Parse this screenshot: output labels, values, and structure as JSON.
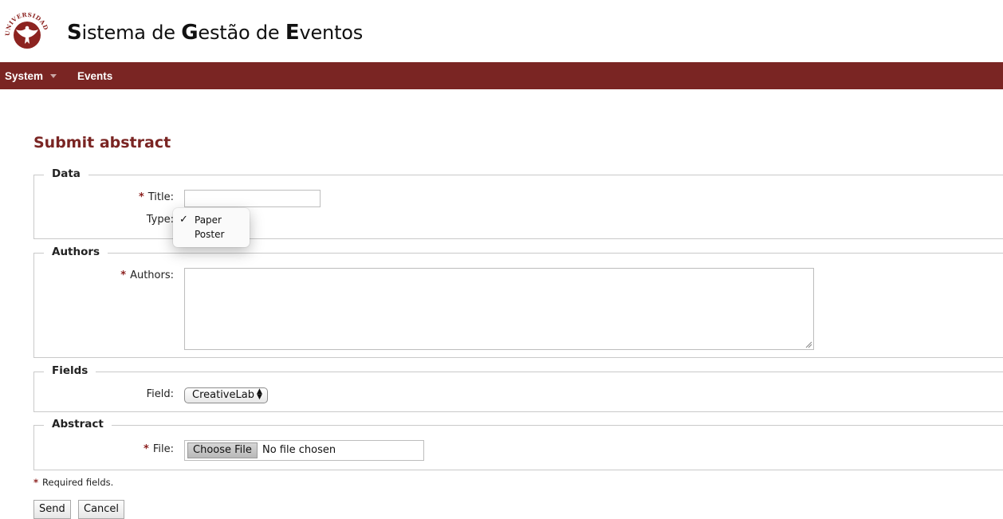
{
  "header": {
    "logo_text": "UNIVERSIDADE DE ÉVORA",
    "title_parts": [
      {
        "cap": "S",
        "rest": "istema de "
      },
      {
        "cap": "G",
        "rest": "estão de "
      },
      {
        "cap": "E",
        "rest": "ventos"
      }
    ]
  },
  "nav": {
    "system_label": "System",
    "events_label": "Events"
  },
  "page": {
    "title": "Submit abstract"
  },
  "sections": {
    "data": {
      "legend": "Data",
      "title_label": "Title:",
      "title_value": "",
      "type_label": "Type:",
      "type_options": [
        {
          "label": "Paper",
          "selected": true
        },
        {
          "label": "Poster",
          "selected": false
        }
      ]
    },
    "authors": {
      "legend": "Authors",
      "authors_label": "Authors:",
      "authors_value": ""
    },
    "fields": {
      "legend": "Fields",
      "field_label": "Field:",
      "field_value": "CreativeLab"
    },
    "abstract": {
      "legend": "Abstract",
      "file_label": "File:",
      "file_button": "Choose File",
      "file_status": "No file chosen"
    }
  },
  "required_mark": "*",
  "required_note": "Required fields.",
  "actions": {
    "send_label": "Send",
    "cancel_label": "Cancel"
  },
  "colors": {
    "brand": "#7a2523",
    "required": "#8b1f1d"
  }
}
